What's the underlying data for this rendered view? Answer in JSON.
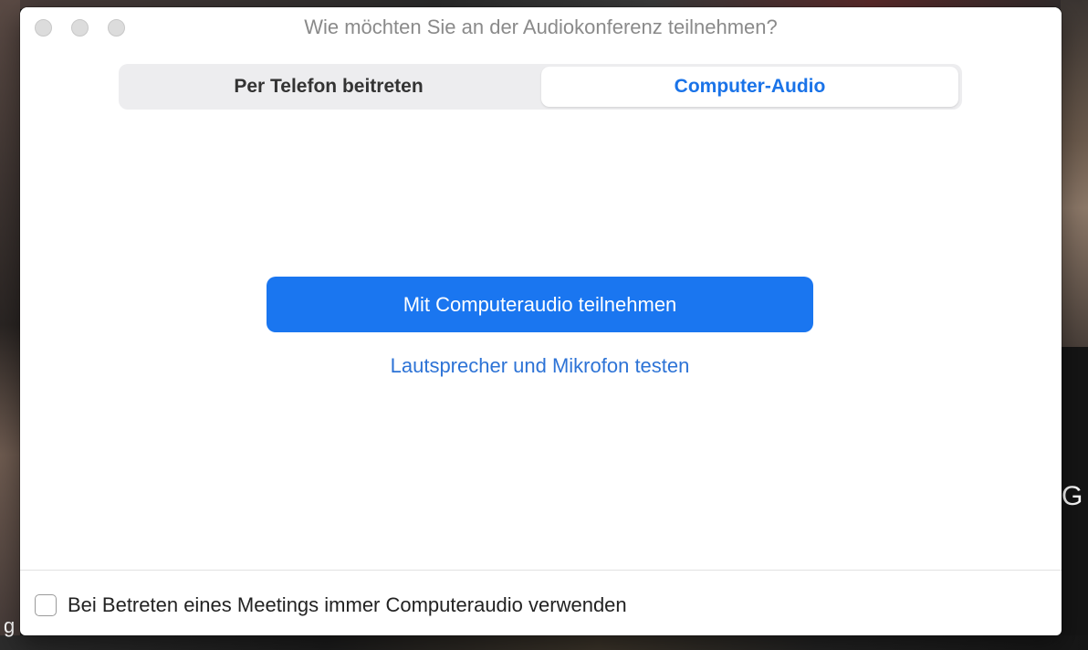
{
  "window": {
    "title": "Wie möchten Sie an der Audiokonferenz teilnehmen?"
  },
  "tabs": {
    "phone_label": "Per Telefon beitreten",
    "computer_label": "Computer-Audio",
    "selected": "Computer-Audio"
  },
  "actions": {
    "join_button_label": "Mit Computeraudio teilnehmen",
    "test_link_label": "Lautsprecher und Mikrofon testen"
  },
  "footer": {
    "checkbox_label": "Bei Betreten eines Meetings immer Computeraudio verwenden",
    "checkbox_checked": false
  },
  "background": {
    "right_edge_text": "G",
    "left_edge_text": "g"
  },
  "colors": {
    "accent": "#1a76f0",
    "link": "#2d73d6",
    "selected_tab_text": "#1a73e8"
  }
}
